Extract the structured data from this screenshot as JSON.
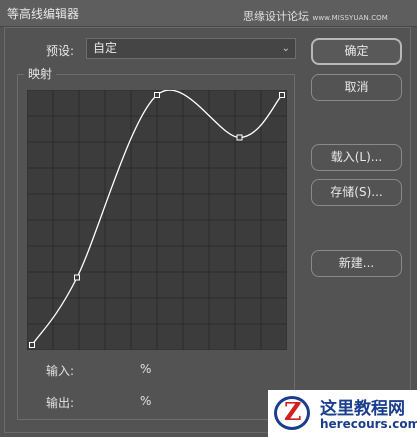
{
  "window": {
    "title": "等高线编辑器",
    "watermark_main": "思缘设计论坛",
    "watermark_url": "www.MISSYUAN.COM"
  },
  "preset": {
    "label": "预设:",
    "value": "自定"
  },
  "buttons": {
    "ok": "确定",
    "cancel": "取消",
    "load": "载入(L)...",
    "save": "存储(S)...",
    "new": "新建..."
  },
  "mapping": {
    "label": "映射",
    "input_label": "输入:",
    "input_unit": "%",
    "output_label": "输出:",
    "output_unit": "%",
    "curve_points": [
      {
        "input": 0,
        "output": 0
      },
      {
        "input": 18,
        "output": 27
      },
      {
        "input": 50,
        "output": 100
      },
      {
        "input": 83,
        "output": 83
      },
      {
        "input": 100,
        "output": 100
      }
    ],
    "grid_divisions": 10
  },
  "badge": {
    "name": "这里教程网",
    "url": "herecours.com"
  },
  "colors": {
    "background": "#535353",
    "graph_bg": "#3c3c3c",
    "grid": "#2b2b2b",
    "curve": "#ffffff"
  }
}
